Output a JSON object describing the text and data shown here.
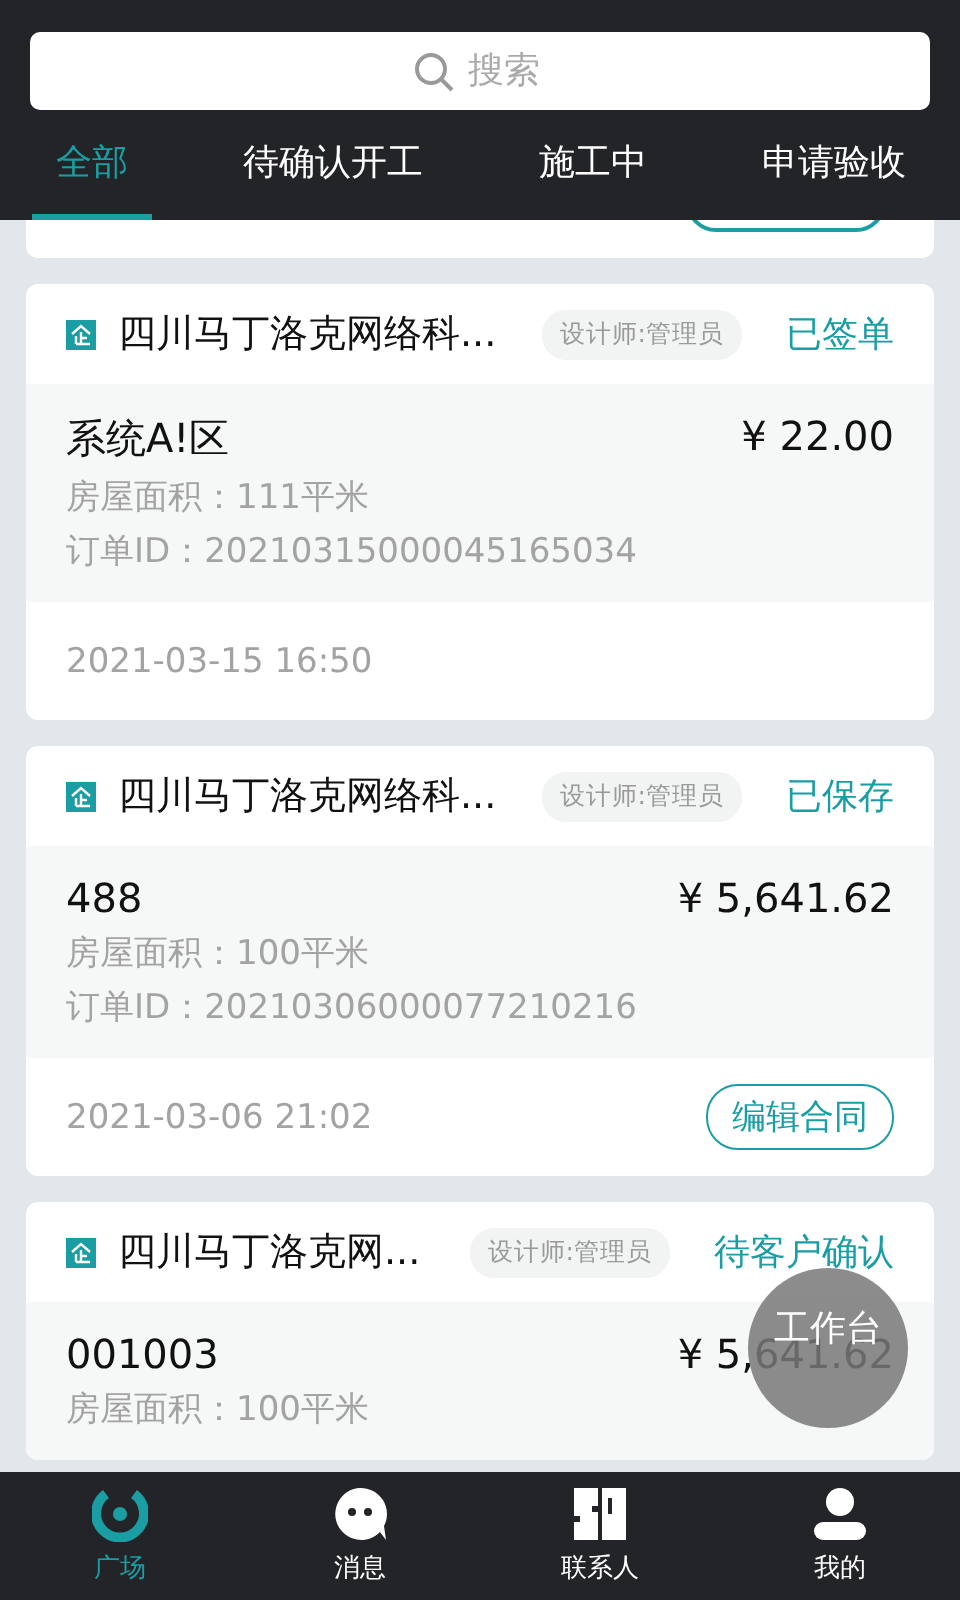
{
  "search": {
    "placeholder": "搜索"
  },
  "tabs": [
    {
      "label": "全部",
      "selected": true
    },
    {
      "label": "待确认开工",
      "selected": false
    },
    {
      "label": "施工中",
      "selected": false
    },
    {
      "label": "申请验收",
      "selected": false
    }
  ],
  "orders": [
    {
      "company": "四川马丁洛克网络科...",
      "designer": "设计师:管理员",
      "status": "已签单",
      "name": "系统A!区",
      "price": "¥ 22.00",
      "area": "房屋面积：111平米",
      "order_id": "订单ID：20210315000045165034",
      "date": "2021-03-15 16:50"
    },
    {
      "company": "四川马丁洛克网络科...",
      "designer": "设计师:管理员",
      "status": "已保存",
      "name": "488",
      "price": "¥ 5,641.62",
      "area": "房屋面积：100平米",
      "order_id": "订单ID：20210306000077210216",
      "date": "2021-03-06 21:02",
      "action": "编辑合同"
    },
    {
      "company": "四川马丁洛克网...",
      "designer": "设计师:管理员",
      "status": "待客户确认",
      "name": "001003",
      "price": "¥ 5,641.62",
      "area": "房屋面积：100平米"
    }
  ],
  "floating_button": {
    "label": "工作台"
  },
  "nav": [
    {
      "kind": "plaza",
      "label": "广场",
      "selected": true
    },
    {
      "kind": "message",
      "label": "消息",
      "selected": false
    },
    {
      "kind": "contacts",
      "label": "联系人",
      "selected": false
    },
    {
      "kind": "profile",
      "label": "我的",
      "selected": false
    }
  ]
}
